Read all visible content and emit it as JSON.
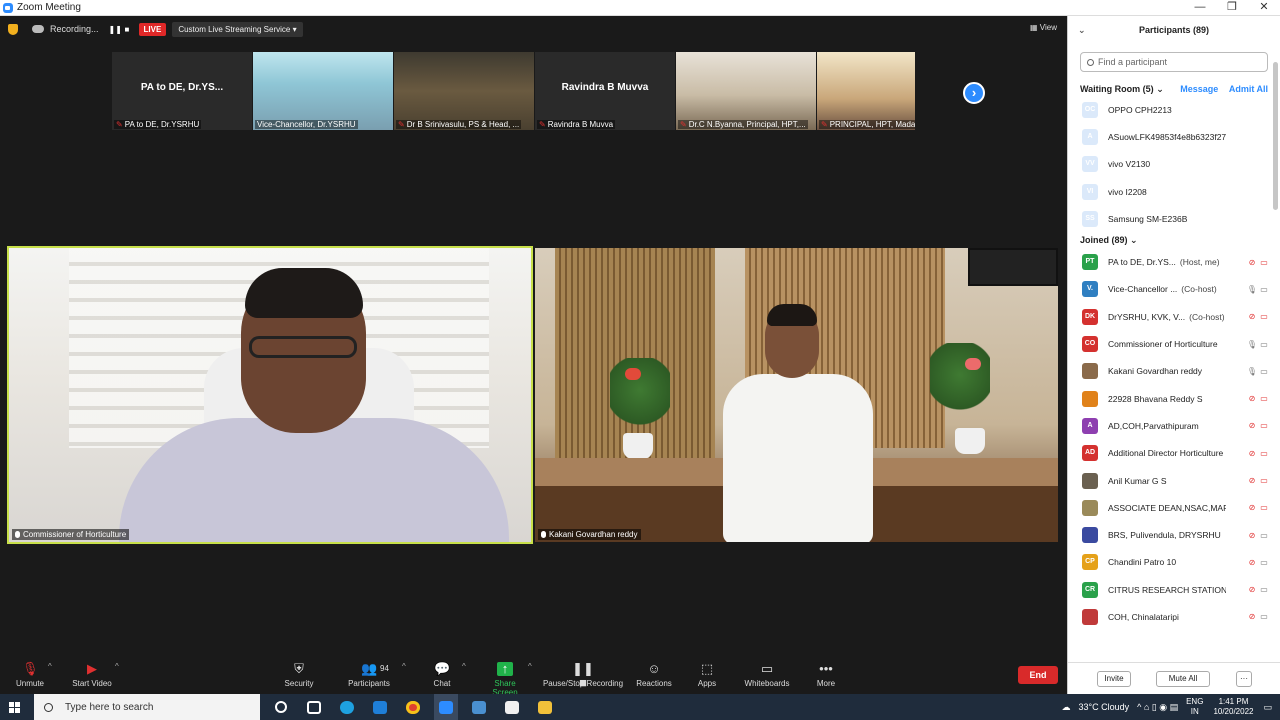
{
  "window": {
    "title": "Zoom Meeting"
  },
  "topbar": {
    "recording": "Recording...",
    "live": "LIVE",
    "streaming": "Custom Live Streaming Service",
    "view": "View"
  },
  "thumbnails": [
    {
      "display_name": "PA to DE, Dr.YS...",
      "label": "PA to DE, Dr.YSRHU"
    },
    {
      "display_name": "",
      "label": "Vice-Chancellor, Dr.YSRHU"
    },
    {
      "display_name": "",
      "label": "Dr B Srinivasulu, PS & Head, ..."
    },
    {
      "display_name": "Ravindra B Muvva",
      "label": "Ravindra B Muvva"
    },
    {
      "display_name": "",
      "label": "Dr.C N.Byanna, Principal, HPT,..."
    },
    {
      "display_name": "",
      "label": "PRINCIPAL, HPT, Madakasira"
    }
  ],
  "main_tiles": [
    {
      "label": "Commissioner of Horticulture"
    },
    {
      "label": "Kakani Govardhan reddy"
    }
  ],
  "toolbar": {
    "unmute": "Unmute",
    "start_video": "Start Video",
    "security": "Security",
    "participants": "Participants",
    "participants_count": "94",
    "chat": "Chat",
    "share_screen": "Share Screen",
    "pause_stop_recording": "Pause/Stop Recording",
    "reactions": "Reactions",
    "apps": "Apps",
    "whiteboards": "Whiteboards",
    "more": "More",
    "end": "End"
  },
  "panel": {
    "title": "Participants (89)",
    "search_placeholder": "Find a participant",
    "waiting_room": "Waiting Room (5)",
    "message": "Message",
    "admit_all": "Admit All",
    "waiting": [
      {
        "initials": "OC",
        "name": "OPPO CPH2213"
      },
      {
        "initials": "A",
        "name": "ASuowLFK49853f4e8b6323f27"
      },
      {
        "initials": "VV",
        "name": "vivo V2130"
      },
      {
        "initials": "VI",
        "name": "vivo I2208"
      },
      {
        "initials": "SS",
        "name": "Samsung SM-E236B"
      }
    ],
    "joined": "Joined (89)",
    "participants": [
      {
        "initials": "PT",
        "name": "PA to DE, Dr.YS...",
        "role": "(Host, me)",
        "color": "#2aa14b"
      },
      {
        "initials": "V.",
        "name": "Vice-Chancellor ...",
        "role": "(Co-host)",
        "color": "#2f7fc1"
      },
      {
        "initials": "DK",
        "name": "DrYSRHU, KVK, V...",
        "role": "(Co-host)",
        "color": "#d4312f"
      },
      {
        "initials": "CO",
        "name": "Commissioner of Horticulture",
        "role": "",
        "color": "#d4312f"
      },
      {
        "initials": "",
        "name": "Kakani Govardhan reddy",
        "role": "",
        "color": "#8a6a4a"
      },
      {
        "initials": "",
        "name": "22928 Bhavana Reddy S",
        "role": "",
        "color": "#e0821a"
      },
      {
        "initials": "A",
        "name": "AD,COH,Parvathipuram",
        "role": "",
        "color": "#8e3fb0"
      },
      {
        "initials": "AD",
        "name": "Additional Director Horticulture",
        "role": "",
        "color": "#d4312f"
      },
      {
        "initials": "",
        "name": "Anil Kumar G S",
        "role": "",
        "color": "#6a6050"
      },
      {
        "initials": "",
        "name": "ASSOCIATE DEAN,NSAC,MARK...",
        "role": "",
        "color": "#9a8a5a"
      },
      {
        "initials": "",
        "name": "BRS, Pulivendula, DRYSRHU",
        "role": "",
        "color": "#3a4aa0"
      },
      {
        "initials": "CP",
        "name": "Chandini Patro 10",
        "role": "",
        "color": "#e5a11a"
      },
      {
        "initials": "CR",
        "name": "CITRUS RESEARCH STATION-TI...",
        "role": "",
        "color": "#2aa14b"
      },
      {
        "initials": "",
        "name": "COH, Chinalataripi",
        "role": "",
        "color": "#c03a3a"
      }
    ],
    "invite": "Invite",
    "mute_all": "Mute All"
  },
  "taskbar": {
    "search_placeholder": "Type here to search",
    "weather": "33°C  Cloudy",
    "lang": "ENG",
    "lang2": "IN",
    "time": "1:41 PM",
    "date": "10/20/2022"
  }
}
